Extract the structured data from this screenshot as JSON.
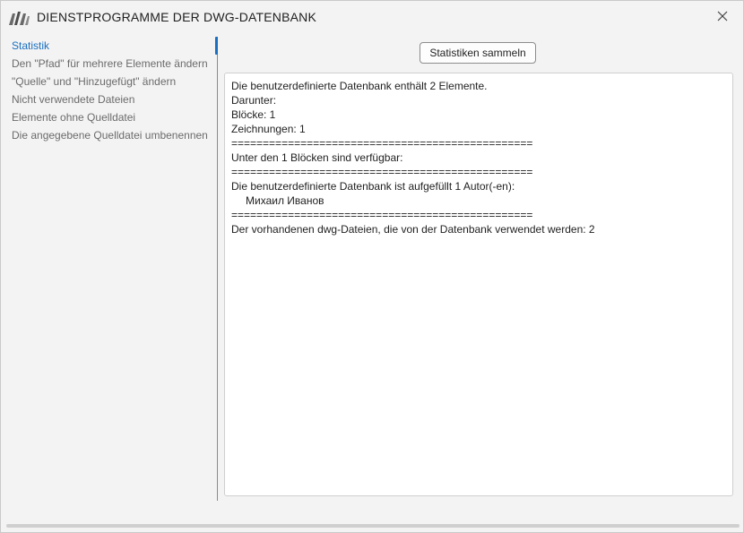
{
  "window": {
    "title": "DIENSTPROGRAMME DER DWG-DATENBANK",
    "accent_color": "#1a6fc0",
    "icons": {
      "logo": "app-logo-icon",
      "close": "close-icon"
    }
  },
  "sidebar": {
    "items": [
      {
        "label": "Statistik",
        "active": true
      },
      {
        "label": "Den \"Pfad\" für mehrere Elemente ändern"
      },
      {
        "label": "\"Quelle\" und \"Hinzugefügt\" ändern"
      },
      {
        "label": "Nicht verwendete Dateien"
      },
      {
        "label": "Elemente ohne Quelldatei"
      },
      {
        "label": "Die angegebene Quelldatei umbenennen"
      }
    ]
  },
  "main": {
    "collect_button_label": "Statistiken sammeln",
    "output_lines": [
      "Die benutzerdefinierte Datenbank enthält 2 Elemente.",
      "Darunter:",
      "Blöcke: 1",
      "Zeichnungen: 1",
      "================================================",
      "Unter den 1 Blöcken sind verfügbar:",
      "================================================",
      "Die benutzerdefinierte Datenbank ist aufgefüllt 1 Autor(-en):",
      "Михаил Иванов",
      "================================================",
      "Der vorhandenen dwg-Dateien, die von der Datenbank verwendet werden: 2"
    ]
  }
}
